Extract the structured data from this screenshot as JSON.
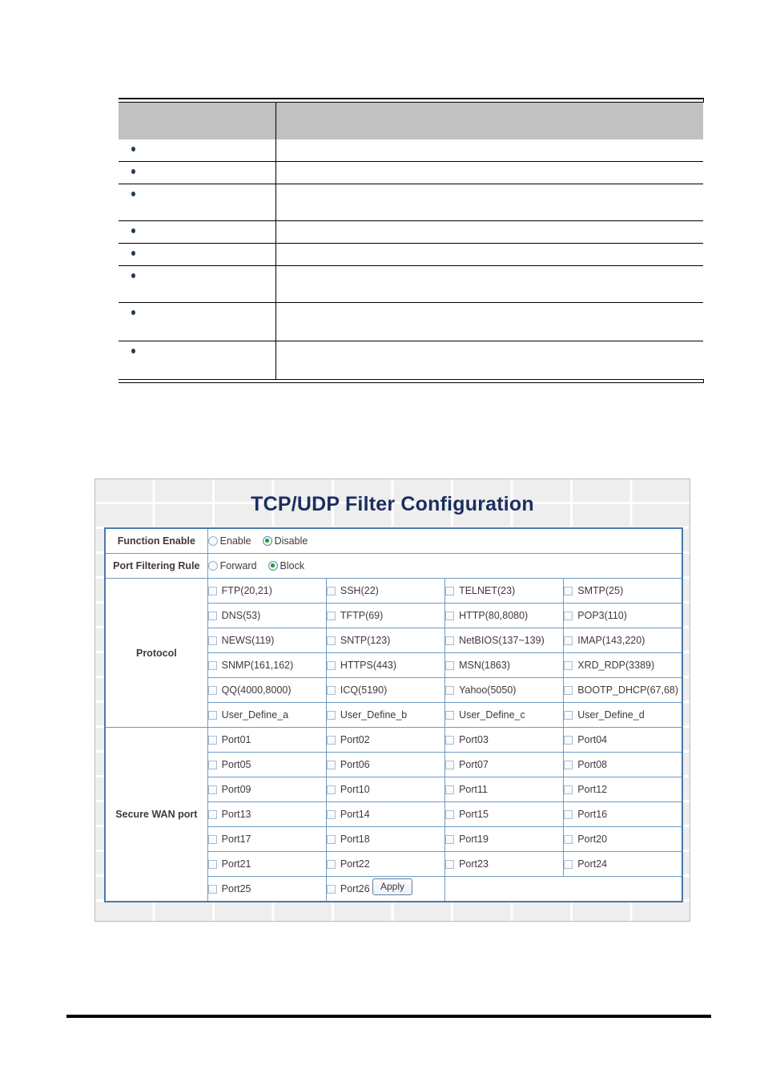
{
  "document": {
    "top_table": {
      "header": {
        "col1": "",
        "col2": ""
      },
      "rows": [
        {
          "bullet": true,
          "col1": "",
          "col2": "",
          "size": "s"
        },
        {
          "bullet": true,
          "col1": "",
          "col2": "",
          "size": "s"
        },
        {
          "bullet": true,
          "col1": "",
          "col2": "",
          "size": "m"
        },
        {
          "bullet": true,
          "col1": "",
          "col2": "",
          "size": "s"
        },
        {
          "bullet": true,
          "col1": "",
          "col2": "",
          "size": "s"
        },
        {
          "bullet": true,
          "col1": "",
          "col2": "",
          "size": "m"
        },
        {
          "bullet": true,
          "col1": "",
          "col2": "",
          "size": "l"
        },
        {
          "bullet": true,
          "col1": "",
          "col2": "",
          "size": "l"
        }
      ]
    }
  },
  "panel": {
    "title": "TCP/UDP Filter Configuration",
    "rows": {
      "function_enable": {
        "label": "Function Enable",
        "options": [
          {
            "label": "Enable",
            "selected": false
          },
          {
            "label": "Disable",
            "selected": true
          }
        ]
      },
      "port_filtering_rule": {
        "label": "Port Filtering Rule",
        "options": [
          {
            "label": "Forward",
            "selected": false
          },
          {
            "label": "Block",
            "selected": true
          }
        ]
      },
      "protocol": {
        "label": "Protocol",
        "grid": [
          [
            "FTP(20,21)",
            "SSH(22)",
            "TELNET(23)",
            "SMTP(25)"
          ],
          [
            "DNS(53)",
            "TFTP(69)",
            "HTTP(80,8080)",
            "POP3(110)"
          ],
          [
            "NEWS(119)",
            "SNTP(123)",
            "NetBIOS(137~139)",
            "IMAP(143,220)"
          ],
          [
            "SNMP(161,162)",
            "HTTPS(443)",
            "MSN(1863)",
            "XRD_RDP(3389)"
          ],
          [
            "QQ(4000,8000)",
            "ICQ(5190)",
            "Yahoo(5050)",
            "BOOTP_DHCP(67,68)"
          ],
          [
            "User_Define_a",
            "User_Define_b",
            "User_Define_c",
            "User_Define_d"
          ]
        ]
      },
      "secure_wan_port": {
        "label": "Secure WAN port",
        "grid": [
          [
            "Port01",
            "Port02",
            "Port03",
            "Port04"
          ],
          [
            "Port05",
            "Port06",
            "Port07",
            "Port08"
          ],
          [
            "Port09",
            "Port10",
            "Port11",
            "Port12"
          ],
          [
            "Port13",
            "Port14",
            "Port15",
            "Port16"
          ],
          [
            "Port17",
            "Port18",
            "Port19",
            "Port20"
          ],
          [
            "Port21",
            "Port22",
            "Port23",
            "Port24"
          ],
          [
            "Port25",
            "Port26"
          ]
        ]
      }
    },
    "apply_label": "Apply"
  },
  "colors": {
    "title": "#1b2f5e",
    "label_bg": "#dce9f7",
    "table_border": "#4a79ab",
    "cell_border": "#6f9bc4",
    "radio_selected": "#17a22c",
    "header_gray": "#c1c1c1",
    "bullet": "#1f3b57"
  }
}
